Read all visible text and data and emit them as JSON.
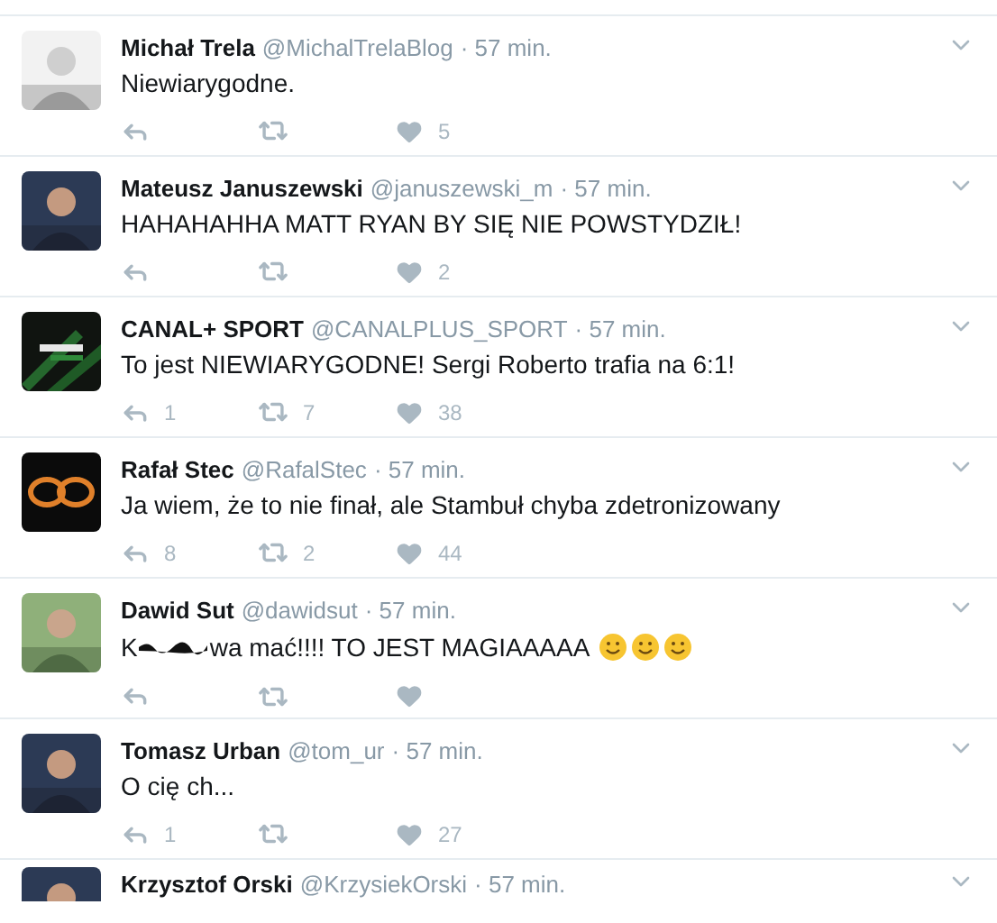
{
  "tweets": [
    {
      "kind": "plain",
      "name": "Michał Trela",
      "handle": "@MichalTrelaBlog",
      "time": "· 57 min.",
      "text": "Niewiarygodne.",
      "likes": "5"
    },
    {
      "kind": "plain",
      "name": "Mateusz Januszewski",
      "handle": "@januszewski_m",
      "time": "· 57 min.",
      "text": "HAHAHAHHA MATT RYAN BY SIĘ NIE POWSTYDZIŁ!",
      "likes": "2"
    },
    {
      "kind": "plain",
      "name": "CANAL+ SPORT",
      "handle": "@CANALPLUS_SPORT",
      "time": "· 57 min.",
      "text": "To jest NIEWIARYGODNE! Sergi Roberto trafia na 6:1!",
      "replies": "1",
      "retweets": "7",
      "likes": "38"
    },
    {
      "kind": "plain",
      "name": "Rafał Stec",
      "handle": "@RafalStec",
      "time": "· 57 min.",
      "text": "Ja wiem, że to nie finał, ale Stambuł chyba zdetronizowany",
      "replies": "8",
      "retweets": "2",
      "likes": "44"
    },
    {
      "kind": "censored",
      "name": "Dawid Sut",
      "handle": "@dawidsut",
      "time": "· 57 min.",
      "text_parts": [
        "K",
        "wa mać!!!! TO JEST MAGIAAAAA"
      ]
    },
    {
      "kind": "plain",
      "name": "Tomasz Urban",
      "handle": "@tom_ur",
      "time": "· 57 min.",
      "text": "O cię ch...",
      "replies": "1",
      "likes": "27"
    },
    {
      "kind": "partial",
      "name": "Krzysztof Orski",
      "handle": "@KrzysiekOrski",
      "time": "· 57 min."
    }
  ]
}
